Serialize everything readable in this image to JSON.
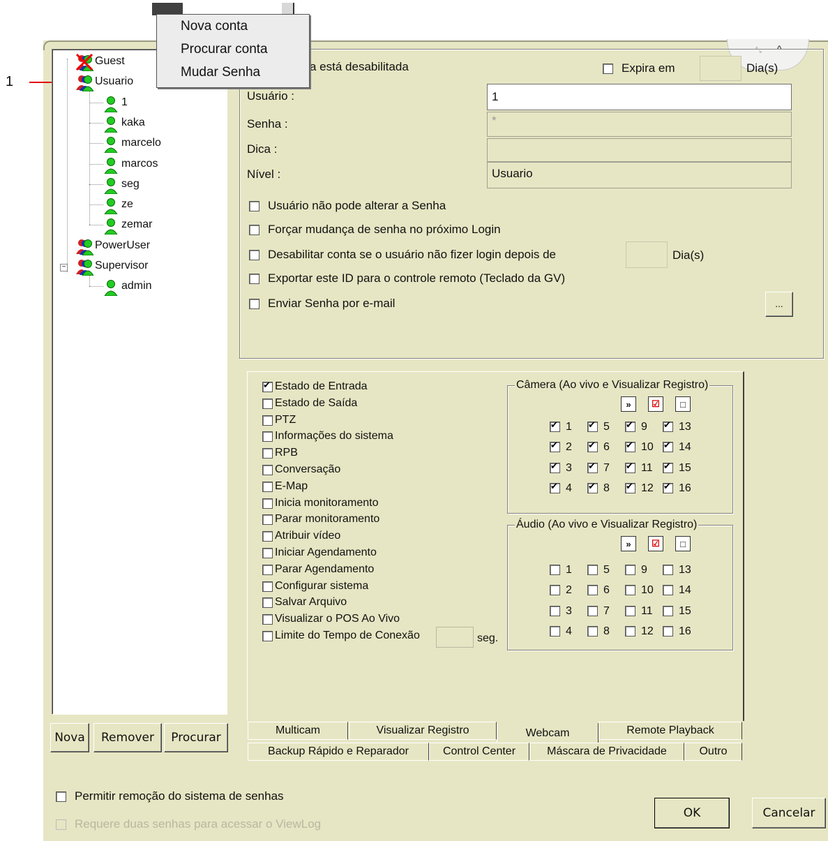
{
  "annotation": {
    "number": "1"
  },
  "context_menu": {
    "items": [
      "Nova conta",
      "Procurar conta",
      "Mudar Senha"
    ]
  },
  "tree": {
    "groups": [
      {
        "label": "Guest",
        "disabled": true
      },
      {
        "label": "Usuario",
        "children": [
          "1",
          "kaka",
          "marcelo",
          "marcos",
          "seg",
          "ze",
          "zemar"
        ]
      },
      {
        "label": "PowerUser"
      },
      {
        "label": "Supervisor",
        "children": [
          "admin"
        ]
      }
    ],
    "buttons": [
      "Nova",
      "Remover",
      "Procurar"
    ]
  },
  "account": {
    "disabled_text": "a está desabilitada",
    "expires_label": "Expira em",
    "days_label": "Dia(s)",
    "user_label": "Usuário :",
    "user_value": "1",
    "password_label": "Senha :",
    "password_value": "*",
    "hint_label": "Dica :",
    "hint_value": "",
    "level_label": "Nível :",
    "level_value": "Usuario",
    "options": [
      "Usuário não pode alterar a Senha",
      "Forçar mudança de senha no próximo Login",
      "Desabilitar conta se o usuário não fizer login depois de",
      "Exportar este ID para o controle remoto (Teclado da GV)",
      "Enviar Senha por e-mail"
    ],
    "disable_days_label": "Dia(s)",
    "ellipsis_button": "..."
  },
  "permissions": {
    "items": [
      {
        "label": "Estado de Entrada",
        "checked": true
      },
      {
        "label": "Estado de Saída",
        "checked": false
      },
      {
        "label": "PTZ",
        "checked": false
      },
      {
        "label": "Informações do sistema",
        "checked": false
      },
      {
        "label": "RPB",
        "checked": false
      },
      {
        "label": "Conversação",
        "checked": false
      },
      {
        "label": "E-Map",
        "checked": false
      },
      {
        "label": "Inicia monitoramento",
        "checked": false
      },
      {
        "label": "Parar monitoramento",
        "checked": false
      },
      {
        "label": "Atribuir vídeo",
        "checked": false
      },
      {
        "label": "Iniciar Agendamento",
        "checked": false
      },
      {
        "label": "Parar Agendamento",
        "checked": false
      },
      {
        "label": "Configurar sistema",
        "checked": false
      },
      {
        "label": "Salvar Arquivo",
        "checked": false
      },
      {
        "label": "Visualizar o POS Ao Vivo",
        "checked": false
      },
      {
        "label": "Limite do Tempo de Conexão",
        "checked": false
      }
    ],
    "seconds_label": "seg.",
    "camera_title": "Câmera (Ao vivo e Visualizar Registro)",
    "audio_title": "Áudio (Ao vivo e Visualizar Registro)",
    "camera_checked": true,
    "audio_checked": false
  },
  "tabs": {
    "row1": [
      "Multicam",
      "Visualizar Registro",
      "Webcam",
      "Remote Playback"
    ],
    "row2": [
      "Backup Rápido e Reparador",
      "Control Center",
      "Máscara de Privacidade",
      "Outro"
    ],
    "active": "Webcam"
  },
  "footer": {
    "allow_removal": "Permitir remoção do sistema de senhas",
    "require_two": "Requere duas senhas para acessar o ViewLog",
    "ok": "OK",
    "cancel": "Cancelar"
  },
  "colors": {
    "background": "#e6e6c4",
    "user_icon": "#22cc22",
    "annotation_arrow": "#e00000"
  }
}
